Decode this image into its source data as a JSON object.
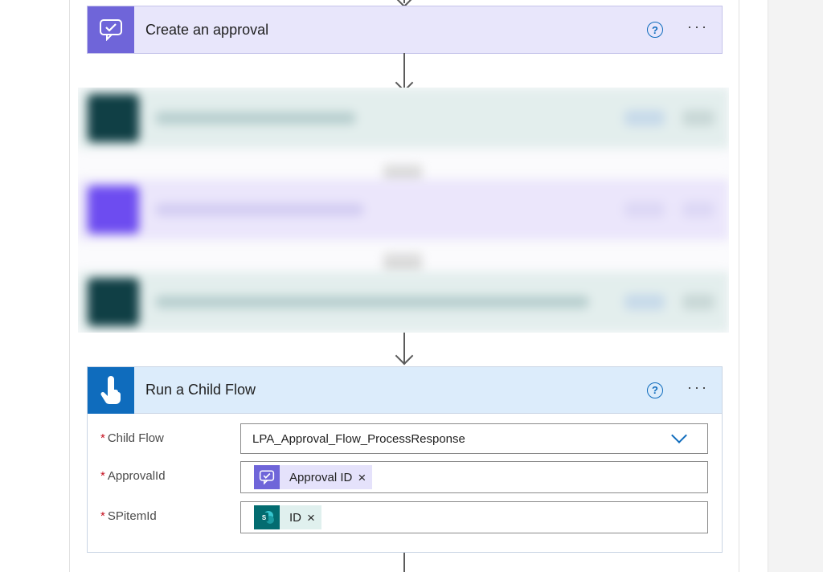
{
  "approval_card": {
    "title": "Create an approval",
    "icon": "approval-icon",
    "help_glyph": "?",
    "more_glyph": "···"
  },
  "child_card": {
    "title": "Run a Child Flow",
    "icon": "touch-icon",
    "help_glyph": "?",
    "more_glyph": "···",
    "fields": [
      {
        "label": "Child Flow",
        "required_mark": "*",
        "value": "LPA_Approval_Flow_ProcessResponse"
      },
      {
        "label": "ApprovalId",
        "required_mark": "*",
        "token": "Approval ID",
        "token_icon": "approval-icon"
      },
      {
        "label": "SPitemId",
        "required_mark": "*",
        "token": "ID",
        "token_icon": "sharepoint-icon"
      }
    ],
    "token_remove_glyph": "×"
  },
  "colors": {
    "approval_accent": "#6f65d9",
    "child_flow_accent": "#0f6cbd",
    "sharepoint_accent": "#036c70",
    "required": "#c50f1f"
  }
}
